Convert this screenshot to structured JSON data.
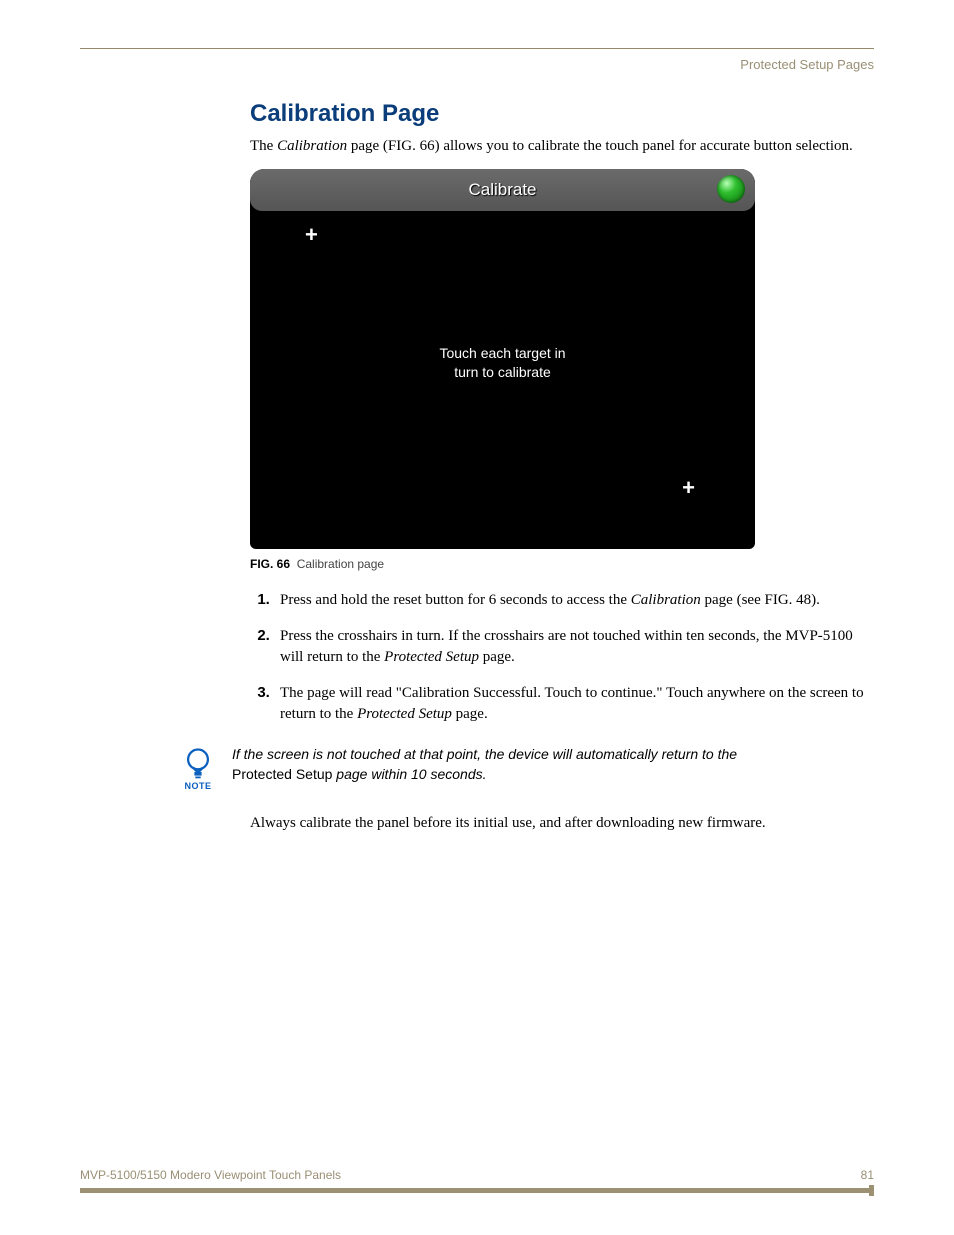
{
  "running_head": "Protected Setup Pages",
  "title": "Calibration Page",
  "intro": {
    "pre": "The ",
    "italic": "Calibration",
    "post": " page (FIG. 66) allows you to calibrate the touch panel for accurate button selection."
  },
  "figure": {
    "header_title": "Calibrate",
    "message_line1": "Touch each target in",
    "message_line2": "turn to calibrate",
    "caption_label": "FIG. 66",
    "caption_text": "Calibration page"
  },
  "steps": [
    {
      "pre": "Press and hold the reset button for 6 seconds to access the ",
      "italic": "Calibration",
      "post": " page (see FIG. 48)."
    },
    {
      "pre": "Press the crosshairs in turn. If the crosshairs are not touched within ten seconds, the MVP-5100 will return to the ",
      "italic": "Protected Setup",
      "post": " page."
    },
    {
      "pre": "The page will read \"Calibration Successful. Touch to continue.\" Touch anywhere on the screen to return to the ",
      "italic": "Protected Setup",
      "post": " page."
    }
  ],
  "note": {
    "icon_label": "NOTE",
    "line1_pre": "If the screen is not touched at that point, the device will automatically return to the ",
    "line2_non_italic": "Protected Setup",
    "line2_post": " page within 10 seconds."
  },
  "after_note": "Always calibrate the panel before its initial use, and after downloading new firmware.",
  "footer": {
    "left": "MVP-5100/5150 Modero Viewpoint  Touch Panels",
    "right": "81"
  }
}
